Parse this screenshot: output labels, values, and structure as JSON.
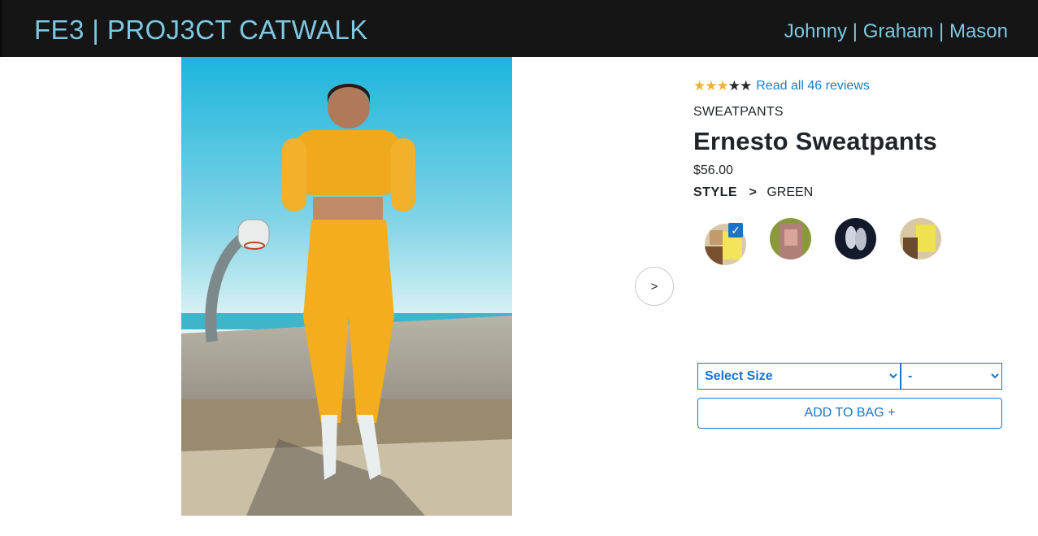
{
  "header": {
    "brand": "FE3 | PROJ3CT CATWALK",
    "authors": "Johnny | Graham | Mason"
  },
  "gallery": {
    "next_label": ">"
  },
  "product": {
    "rating": 3.5,
    "rating_stars_max": 5,
    "reviews_link": "Read all 46 reviews",
    "category": "SWEATPANTS",
    "name": "Ernesto Sweatpants",
    "price": "$56.00",
    "style_label": "STYLE",
    "style_separator": ">",
    "style_name": "GREEN"
  },
  "styles": {
    "selected_index": 0,
    "check_mark": "✓"
  },
  "cart": {
    "size_placeholder": "Select Size",
    "qty_placeholder": "-",
    "add_label": "ADD TO BAG +"
  },
  "colors": {
    "header_bg": "#151515",
    "header_text": "#7ec8e3",
    "accent": "#1a73c9",
    "star": "#f2b233"
  }
}
